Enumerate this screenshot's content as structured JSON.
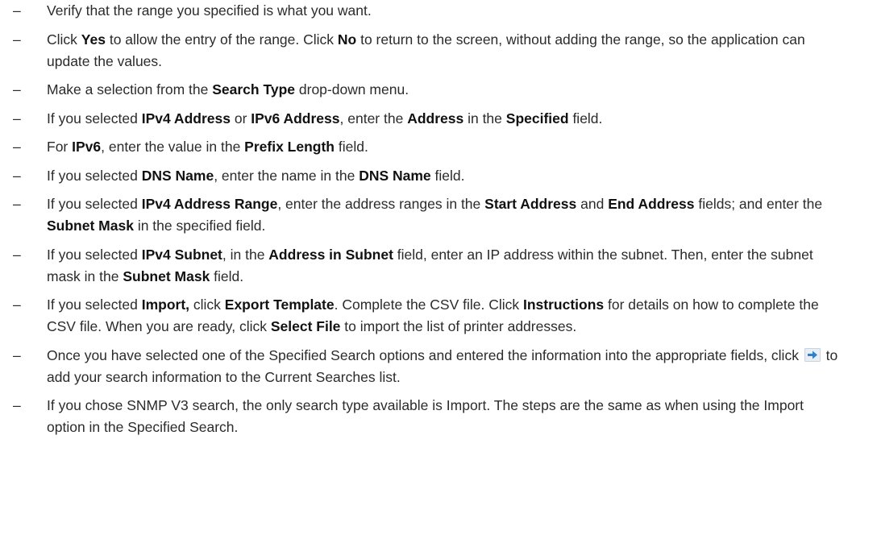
{
  "steps": [
    {
      "parts": [
        {
          "t": "Verify that the range you specified is what you want."
        }
      ]
    },
    {
      "parts": [
        {
          "t": "Click "
        },
        {
          "t": "Yes",
          "b": true
        },
        {
          "t": " to allow the entry of the range. Click "
        },
        {
          "t": "No",
          "b": true
        },
        {
          "t": " to return to the screen, without adding the range, so the application can update the values."
        }
      ]
    },
    {
      "parts": [
        {
          "t": "Make a selection from the "
        },
        {
          "t": "Search Type",
          "b": true
        },
        {
          "t": " drop-down menu."
        }
      ]
    },
    {
      "parts": [
        {
          "t": "If you selected "
        },
        {
          "t": "IPv4 Address",
          "b": true
        },
        {
          "t": " or "
        },
        {
          "t": "IPv6 Address",
          "b": true
        },
        {
          "t": ", enter the "
        },
        {
          "t": "Address",
          "b": true
        },
        {
          "t": " in the "
        },
        {
          "t": "Specified",
          "b": true
        },
        {
          "t": " field."
        }
      ]
    },
    {
      "parts": [
        {
          "t": "For "
        },
        {
          "t": "IPv6",
          "b": true
        },
        {
          "t": ", enter the value in the "
        },
        {
          "t": "Prefix Length",
          "b": true
        },
        {
          "t": " field."
        }
      ]
    },
    {
      "parts": [
        {
          "t": "If you selected "
        },
        {
          "t": "DNS Name",
          "b": true
        },
        {
          "t": ", enter the name in the "
        },
        {
          "t": "DNS Name",
          "b": true
        },
        {
          "t": " field."
        }
      ]
    },
    {
      "parts": [
        {
          "t": "If you selected "
        },
        {
          "t": "IPv4 Address Range",
          "b": true
        },
        {
          "t": ", enter the address ranges in the "
        },
        {
          "t": "Start Address",
          "b": true
        },
        {
          "t": " and "
        },
        {
          "t": "End Address",
          "b": true
        },
        {
          "t": " fields; and enter the "
        },
        {
          "t": "Subnet Mask",
          "b": true
        },
        {
          "t": " in the specified field."
        }
      ]
    },
    {
      "parts": [
        {
          "t": "If you selected "
        },
        {
          "t": "IPv4 Subnet",
          "b": true
        },
        {
          "t": ", in the "
        },
        {
          "t": "Address in Subnet",
          "b": true
        },
        {
          "t": " field, enter an IP address within the subnet. Then, enter the subnet mask in the "
        },
        {
          "t": "Subnet Mask",
          "b": true
        },
        {
          "t": " field."
        }
      ]
    },
    {
      "parts": [
        {
          "t": "If you selected "
        },
        {
          "t": "Import,",
          "b": true
        },
        {
          "t": " click "
        },
        {
          "t": "Export Template",
          "b": true
        },
        {
          "t": ". Complete the CSV file. Click "
        },
        {
          "t": "Instructions",
          "b": true
        },
        {
          "t": " for details on how to complete the CSV file. When you are ready, click "
        },
        {
          "t": "Select File",
          "b": true
        },
        {
          "t": " to import the list of printer addresses."
        }
      ]
    },
    {
      "parts": [
        {
          "t": "Once you have selected one of the Specified Search options and entered the information into the appropriate fields, click "
        },
        {
          "icon": "add-arrow-icon"
        },
        {
          "t": " to add your search information to the Current Searches list."
        }
      ]
    },
    {
      "parts": [
        {
          "t": "If you chose SNMP V3 search, the only search type available is Import. The steps are the same as when using the Import option in the Specified Search."
        }
      ]
    }
  ],
  "bullet": "–",
  "colors": {
    "text": "#2b2b2b",
    "icon_bg": "#e8eef6",
    "icon_arrow": "#2f7fc9"
  }
}
